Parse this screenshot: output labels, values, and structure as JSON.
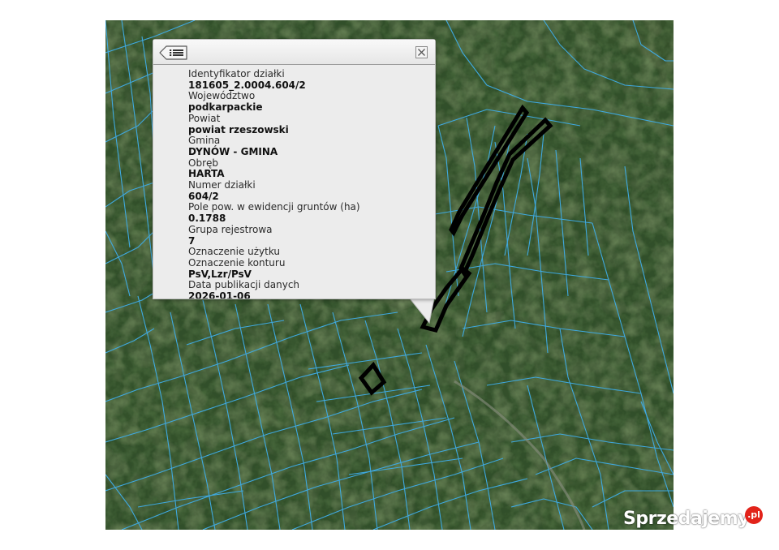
{
  "popup": {
    "fields": [
      {
        "label": "Identyfikator działki",
        "value": "181605_2.0004.604/2"
      },
      {
        "label": "Województwo",
        "value": "podkarpackie"
      },
      {
        "label": "Powiat",
        "value": "powiat rzeszowski"
      },
      {
        "label": "Gmina",
        "value": "DYNÓW - GMINA"
      },
      {
        "label": "Obręb",
        "value": "HARTA"
      },
      {
        "label": "Numer działki",
        "value": "604/2"
      },
      {
        "label": "Pole pow. w ewidencji gruntów (ha)",
        "value": "0.1788"
      },
      {
        "label": "Grupa rejestrowa",
        "value": "7"
      },
      {
        "label": "Oznaczenie użytku",
        "value": ""
      },
      {
        "label": "Oznaczenie konturu",
        "value": "PsV,Lzr/PsV"
      },
      {
        "label": "Data publikacji danych",
        "value": "2026-01-06"
      }
    ]
  },
  "icons": {
    "back": "list-back-icon",
    "close": "close-icon"
  },
  "watermark": {
    "text": "Sprzedajemy",
    "badge": ".pl"
  },
  "colors": {
    "parcel_lines": "#3fa9e0",
    "highlight": "#000000",
    "forest": "#2e4a23",
    "meadow": "#7d9b4d",
    "popup_bg": "#ececec",
    "badge": "#e2231a"
  }
}
